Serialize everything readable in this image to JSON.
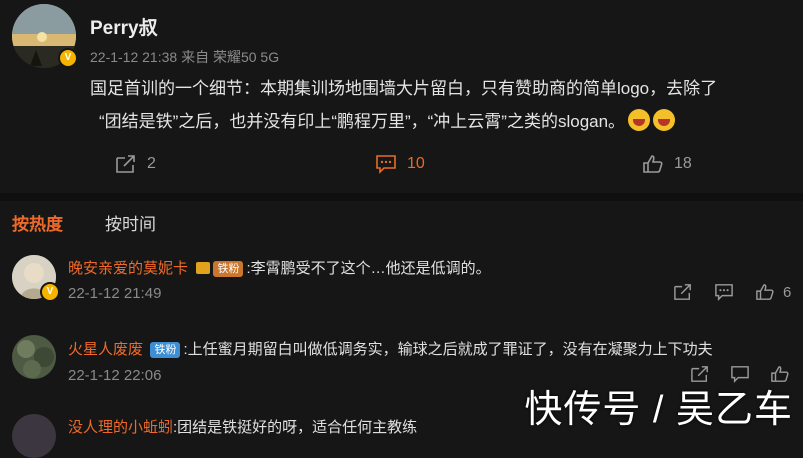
{
  "post": {
    "author": "Perry叔",
    "meta": "22-1-12 21:38  来自 荣耀50 5G",
    "text_line1": "国足首训的一个细节：本期集训场地围墙大片留白，只有赞助商的简单logo，去除了",
    "text_line2": "“团结是铁”之后，也并没有印上“鹏程万里”，“冲上云霄”之类的slogan。",
    "verified_badge": "V",
    "actions": {
      "share_count": "2",
      "comment_count": "10",
      "like_count": "18"
    }
  },
  "tabs": {
    "hot": "按热度",
    "time": "按时间"
  },
  "comments": [
    {
      "name": "晚安亲爱的莫妮卡",
      "fan_badge": "铁粉",
      "text": ":李霄鹏受不了这个…他还是低调的。",
      "time": "22-1-12 21:49",
      "like_count": "6"
    },
    {
      "name": "火星人废废",
      "fan_badge": "铁粉",
      "text": ":上任蜜月期留白叫做低调务实，输球之后就成了罪证了，没有在凝聚力上下功夫",
      "time": "22-1-12 22:06",
      "like_count": ""
    },
    {
      "name": "没人理的小蚯蚓",
      "text": ":团结是铁挺好的呀，适合任何主教练"
    }
  ],
  "watermark": "快传号 / 吴乙车",
  "colors": {
    "background": "#161616",
    "accent": "#ee6a2a",
    "muted": "#8a8a8a",
    "fan_blue": "#3e8ed3"
  },
  "icons": [
    "share-icon",
    "comment-icon",
    "like-icon"
  ]
}
